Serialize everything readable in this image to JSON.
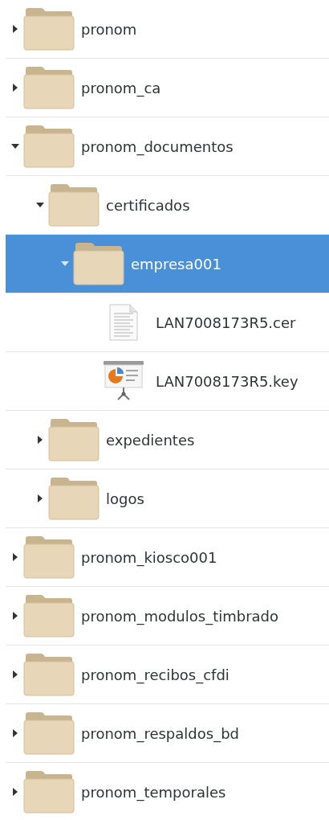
{
  "tree": [
    {
      "kind": "folder",
      "name": "pronom",
      "expanded": false,
      "selected": false
    },
    {
      "kind": "folder",
      "name": "pronom_ca",
      "expanded": false,
      "selected": false
    },
    {
      "kind": "folder",
      "name": "pronom_documentos",
      "expanded": true,
      "selected": false,
      "children": [
        {
          "kind": "folder",
          "name": "certificados",
          "expanded": true,
          "selected": false,
          "children": [
            {
              "kind": "folder",
              "name": "empresa001",
              "expanded": true,
              "selected": true,
              "children": [
                {
                  "kind": "document",
                  "name": "LAN7008173R5.cer",
                  "selected": false
                },
                {
                  "kind": "presentation",
                  "name": "LAN7008173R5.key",
                  "selected": false
                }
              ]
            }
          ]
        },
        {
          "kind": "folder",
          "name": "expedientes",
          "expanded": false,
          "selected": false
        },
        {
          "kind": "folder",
          "name": "logos",
          "expanded": false,
          "selected": false
        }
      ]
    },
    {
      "kind": "folder",
      "name": "pronom_kiosco001",
      "expanded": false,
      "selected": false
    },
    {
      "kind": "folder",
      "name": "pronom_modulos_timbrado",
      "expanded": false,
      "selected": false
    },
    {
      "kind": "folder",
      "name": "pronom_recibos_cfdi",
      "expanded": false,
      "selected": false
    },
    {
      "kind": "folder",
      "name": "pronom_respaldos_bd",
      "expanded": false,
      "selected": false
    },
    {
      "kind": "folder",
      "name": "pronom_temporales",
      "expanded": false,
      "selected": false
    }
  ]
}
